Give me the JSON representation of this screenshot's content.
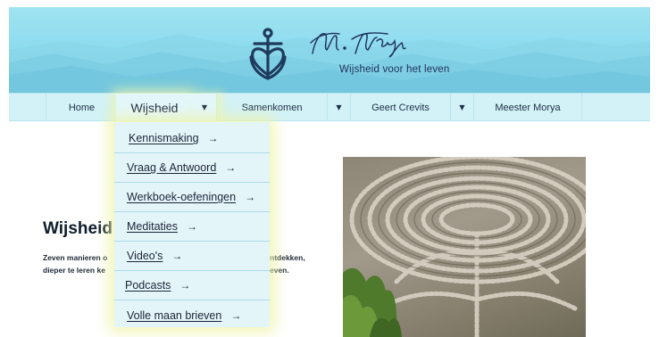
{
  "header": {
    "brand_signature": "M. Morya",
    "tagline": "Wijsheid voor het leven",
    "logo_icon": "anchor-heart-cross-emblem"
  },
  "nav": {
    "items": [
      {
        "label": "Home"
      },
      {
        "label": "Wijsheid",
        "has_dropdown": true,
        "active": true
      },
      {
        "label": "Samenkomen",
        "has_dropdown": true
      },
      {
        "label": "Geert Crevits",
        "has_dropdown": true
      },
      {
        "label": "Meester Morya"
      }
    ],
    "dropdown_arrow": "▼"
  },
  "dropdown": {
    "items": [
      {
        "label": "Kennismaking",
        "arrow": "→"
      },
      {
        "label": "Vraag & Antwoord",
        "arrow": "→"
      },
      {
        "label": "Werkboek-oefeningen",
        "arrow": "→"
      },
      {
        "label": "Meditaties",
        "arrow": "→"
      },
      {
        "label": "Video's",
        "arrow": "→"
      },
      {
        "label": "Podcasts",
        "arrow": "→"
      },
      {
        "label": "Volle maan brieven",
        "arrow": "→"
      }
    ]
  },
  "main": {
    "title": "Wijsheid",
    "intro_left": [
      "Zeven manieren o",
      "dieper te leren ke"
    ],
    "intro_right": [
      "ntdekken,",
      "even."
    ],
    "photo_subject": "stone-labyrinth-photo"
  },
  "colors": {
    "header_sky": "#9fe3f1",
    "nav_bg": "#d2f2f8",
    "dropdown_bg": "#e4f5f9",
    "highlight_glow": "#eef4a5",
    "emblem": "#1f3b5c"
  }
}
